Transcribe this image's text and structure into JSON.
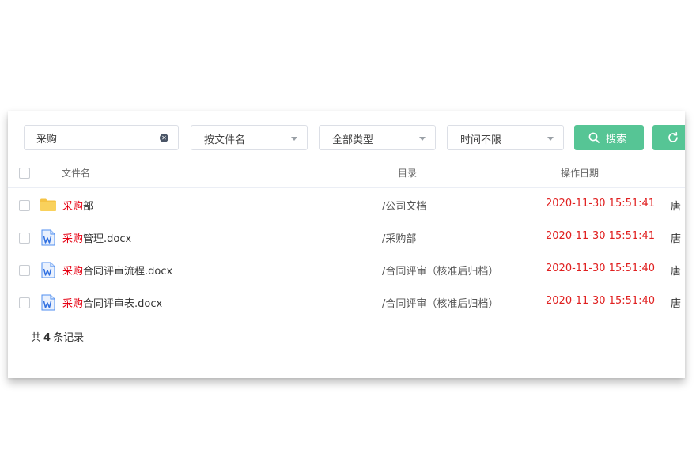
{
  "search": {
    "value": "采购"
  },
  "filters": {
    "name_mode": "按文件名",
    "type": "全部类型",
    "time": "时间不限"
  },
  "buttons": {
    "search_label": "搜索"
  },
  "colors": {
    "accent": "#56c595",
    "highlight": "#e60012",
    "date": "#e02020"
  },
  "columns": {
    "name": "文件名",
    "dir": "目录",
    "date": "操作日期"
  },
  "rows": [
    {
      "icon": "folder-icon",
      "highlight": "采购",
      "rest": "部",
      "path": "/公司文档",
      "date": "2020-11-30 15:51:41",
      "owner": "唐"
    },
    {
      "icon": "word-doc-icon",
      "highlight": "采购",
      "rest": "管理.docx",
      "path": "/采购部",
      "date": "2020-11-30 15:51:41",
      "owner": "唐"
    },
    {
      "icon": "word-doc-icon",
      "highlight": "采购",
      "rest": "合同评审流程.docx",
      "path": "/合同评审（核准后归档）",
      "date": "2020-11-30 15:51:40",
      "owner": "唐"
    },
    {
      "icon": "word-doc-icon",
      "highlight": "采购",
      "rest": "合同评审表.docx",
      "path": "/合同评审（核准后归档）",
      "date": "2020-11-30 15:51:40",
      "owner": "唐"
    }
  ],
  "footer": {
    "prefix": "共",
    "count": "4",
    "suffix": "条记录"
  }
}
